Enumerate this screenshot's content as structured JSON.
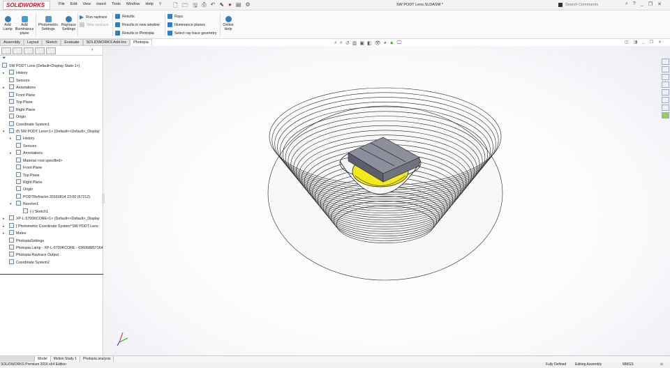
{
  "app": {
    "logo": "SOLIDWORKS",
    "document_title": "SW PODT Lens.SLDASM *",
    "search_placeholder": "Search Commands"
  },
  "menu": [
    "File",
    "Edit",
    "View",
    "Insert",
    "Tools",
    "Window",
    "Help"
  ],
  "ribbon": {
    "add_lamp": "Add Lamp",
    "add_illuminance_plane": "Add Illuminance plane",
    "photometric_settings": "Photometric Settings",
    "raytrace_settings": "Raytrace Settings",
    "run_raytrace": "Run raytrace",
    "stop_raytrace": "Stop raytrace",
    "results": "Results",
    "results_new_window": "Results in new window",
    "results_photopia": "Results in Photopia",
    "rays": "Rays",
    "illuminance_planes": "Illuminance planes",
    "select_geometry": "Select ray trace geometry",
    "online_help": "Online Help"
  },
  "tabs": [
    "Assembly",
    "Layout",
    "Sketch",
    "Evaluate",
    "SOLIDWORKS Add-Ins",
    "Photopia"
  ],
  "tree": [
    {
      "label": "SW PODT Lens  (Default<Display State-1>)",
      "level": 0,
      "expand": ""
    },
    {
      "label": "History",
      "level": 1,
      "expand": "▸"
    },
    {
      "label": "Sensors",
      "level": 1,
      "expand": ""
    },
    {
      "label": "Annotations",
      "level": 1,
      "expand": "▸"
    },
    {
      "label": "Front Plane",
      "level": 1,
      "expand": ""
    },
    {
      "label": "Top Plane",
      "level": 1,
      "expand": ""
    },
    {
      "label": "Right Plane",
      "level": 1,
      "expand": ""
    },
    {
      "label": "Origin",
      "level": 1,
      "expand": ""
    },
    {
      "label": "Coordinate System1",
      "level": 1,
      "expand": ""
    },
    {
      "label": "(f) SW PODT Lens<1> (Default<<Default>_Display",
      "level": 1,
      "expand": "▾"
    },
    {
      "label": "History",
      "level": 2,
      "expand": "▸"
    },
    {
      "label": "Sensors",
      "level": 2,
      "expand": ""
    },
    {
      "label": "Annotations",
      "level": 2,
      "expand": "▸"
    },
    {
      "label": "Material <not specified>",
      "level": 2,
      "expand": ""
    },
    {
      "label": "Front Plane",
      "level": 2,
      "expand": ""
    },
    {
      "label": "Top Plane",
      "level": 2,
      "expand": ""
    },
    {
      "label": "Right Plane",
      "level": 2,
      "expand": ""
    },
    {
      "label": "Origin",
      "level": 2,
      "expand": ""
    },
    {
      "label": "PODTRefractor 20160814 23:00 (67212)",
      "level": 2,
      "expand": ""
    },
    {
      "label": "Revolve1",
      "level": 2,
      "expand": "▾"
    },
    {
      "label": "(-) Sketch1",
      "level": 3,
      "expand": ""
    },
    {
      "label": "XP-L-5700KCORE<1> (Default<<Default>_Display",
      "level": 1,
      "expand": "▸"
    },
    {
      "label": "[ Photometric Coordinate System^SW PODT Lens",
      "level": 1,
      "expand": "▸"
    },
    {
      "label": "Mates",
      "level": 1,
      "expand": "▸"
    },
    {
      "label": "PhotopiaSettings",
      "level": 1,
      "expand": ""
    },
    {
      "label": "Photopia Lamp - XP-L-5700KCORE - 636068857164",
      "level": 1,
      "expand": ""
    },
    {
      "label": "Photopia Raytrace Output",
      "level": 1,
      "expand": ""
    },
    {
      "label": "Coordinate System2",
      "level": 1,
      "expand": ""
    }
  ],
  "bottom_tabs": [
    "Model",
    "Motion Study 1",
    "Photopia analysis"
  ],
  "status": {
    "edition": "SOLIDWORKS Premium 2016 x64 Edition",
    "defined": "Fully Defined",
    "mode": "Editing Assembly",
    "units": "MMGS"
  },
  "colors": {
    "brand": "#c8102e",
    "led": "#f2ea1a",
    "accent": "#2e7fc0"
  }
}
